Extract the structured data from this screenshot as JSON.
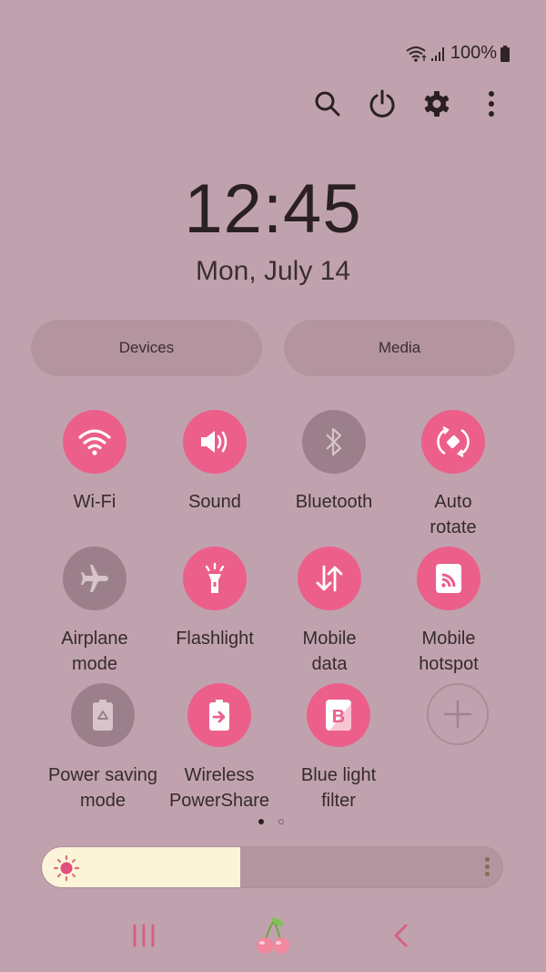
{
  "status_bar": {
    "battery_text": "100%",
    "icons": [
      "wifi-icon",
      "signal-icon",
      "battery-icon"
    ]
  },
  "toolbar": {
    "buttons": [
      {
        "name": "search",
        "icon": "search-icon"
      },
      {
        "name": "power",
        "icon": "power-icon"
      },
      {
        "name": "settings",
        "icon": "gear-icon"
      },
      {
        "name": "more",
        "icon": "more-vertical-icon"
      }
    ]
  },
  "clock": {
    "time": "12:45",
    "date": "Mon, July 14"
  },
  "pills": {
    "devices": "Devices",
    "media": "Media"
  },
  "tiles": [
    {
      "label": "Wi-Fi",
      "state": "on",
      "icon": "wifi-icon"
    },
    {
      "label": "Sound",
      "state": "on",
      "icon": "speaker-icon"
    },
    {
      "label": "Bluetooth",
      "state": "off",
      "icon": "bluetooth-icon"
    },
    {
      "label": "Auto\nrotate",
      "state": "on",
      "icon": "rotate-icon"
    },
    {
      "label": "Airplane\nmode",
      "state": "off",
      "icon": "airplane-icon"
    },
    {
      "label": "Flashlight",
      "state": "on",
      "icon": "flashlight-icon"
    },
    {
      "label": "Mobile\ndata",
      "state": "on",
      "icon": "data-arrows-icon"
    },
    {
      "label": "Mobile\nhotspot",
      "state": "on",
      "icon": "hotspot-icon"
    },
    {
      "label": "Power saving\nmode",
      "state": "off",
      "icon": "battery-recycle-icon"
    },
    {
      "label": "Wireless\nPowerShare",
      "state": "on",
      "icon": "battery-share-icon"
    },
    {
      "label": "Blue light\nfilter",
      "state": "on",
      "icon": "blue-light-icon"
    },
    {
      "label": "",
      "state": "add",
      "icon": "plus-icon"
    }
  ],
  "pager": {
    "pages": 2,
    "current": 1
  },
  "brightness": {
    "level_percent": 43
  },
  "colors": {
    "accent": "#ec5f8b",
    "inactive": "#9b808b",
    "background": "#c0a2ae"
  },
  "navbar": {
    "buttons": [
      "recents-icon",
      "home-cherry-icon",
      "back-icon"
    ]
  }
}
